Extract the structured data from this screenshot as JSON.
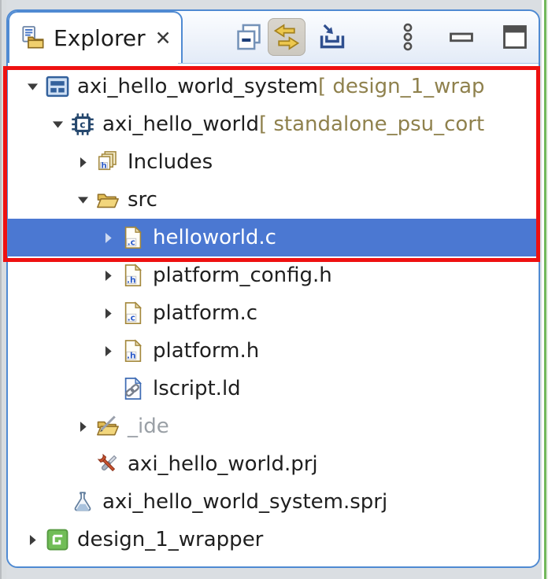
{
  "tab": {
    "icon": "explorer-icon",
    "label": "Explorer",
    "close_glyph": "✕"
  },
  "toolbar": {
    "buttons": [
      {
        "id": "collapse-all",
        "icon": "collapse-all-icon",
        "pressed": false
      },
      {
        "id": "link-with-editor",
        "icon": "link-with-editor-icon",
        "pressed": true
      },
      {
        "id": "import",
        "icon": "arrow-into-tray-icon",
        "pressed": false
      },
      {
        "id": "view-menu",
        "icon": "view-menu-icon",
        "pressed": false
      },
      {
        "id": "minimize",
        "icon": "minimize-icon",
        "pressed": false
      },
      {
        "id": "maximize",
        "icon": "maximize-icon",
        "pressed": false
      }
    ]
  },
  "tree": {
    "items": [
      {
        "label": "axi_hello_world_system",
        "suffix": " [ design_1_wrap",
        "icon": "system-project-icon",
        "level": 0,
        "expander": "expanded",
        "selected": false,
        "muted": false
      },
      {
        "label": "axi_hello_world",
        "suffix": " [ standalone_psu_cort",
        "icon": "application-project-icon",
        "level": 1,
        "expander": "expanded",
        "selected": false,
        "muted": false
      },
      {
        "label": "Includes",
        "icon": "includes-icon",
        "level": 2,
        "expander": "collapsed",
        "selected": false,
        "muted": false
      },
      {
        "label": "src",
        "icon": "open-folder-icon",
        "level": 2,
        "expander": "expanded",
        "selected": false,
        "muted": false
      },
      {
        "label": "helloworld.c",
        "icon": "c-file-icon",
        "level": 3,
        "expander": "collapsed",
        "selected": true,
        "muted": false
      },
      {
        "label": "platform_config.h",
        "icon": "h-file-icon",
        "level": 3,
        "expander": "collapsed",
        "selected": false,
        "muted": false
      },
      {
        "label": "platform.c",
        "icon": "c-file-icon",
        "level": 3,
        "expander": "collapsed",
        "selected": false,
        "muted": false
      },
      {
        "label": "platform.h",
        "icon": "h-file-icon",
        "level": 3,
        "expander": "collapsed",
        "selected": false,
        "muted": false
      },
      {
        "label": "lscript.ld",
        "icon": "linker-script-icon",
        "level": 3,
        "expander": "none",
        "selected": false,
        "muted": false
      },
      {
        "label": "_ide",
        "icon": "ide-folder-icon",
        "level": 2,
        "expander": "collapsed",
        "selected": false,
        "muted": true
      },
      {
        "label": "axi_hello_world.prj",
        "icon": "project-file-icon",
        "level": 2,
        "expander": "none",
        "selected": false,
        "muted": false
      },
      {
        "label": "axi_hello_world_system.sprj",
        "icon": "system-project-file-icon",
        "level": 1,
        "expander": "none",
        "selected": false,
        "muted": false
      },
      {
        "label": "design_1_wrapper",
        "icon": "platform-project-icon",
        "level": 0,
        "expander": "collapsed",
        "selected": false,
        "muted": false
      }
    ]
  },
  "annotation": {
    "type": "highlight-box",
    "color": "#ee1111"
  },
  "colors": {
    "accent": "#4f8ad2",
    "selection": "#4b78d2",
    "selection-text": "#ffffff",
    "suffix": "#8f814d",
    "muted": "#9aa0a6",
    "annotation": "#ee1111",
    "green-edge": "#72b85c",
    "text": "#1f1f1f"
  }
}
